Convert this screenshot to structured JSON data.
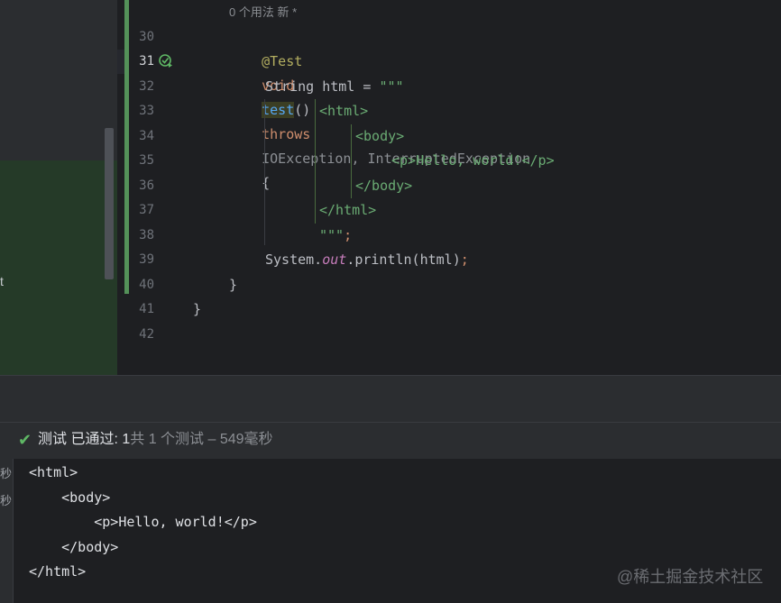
{
  "editor": {
    "usage_hint": "0 个用法  新 *",
    "line_numbers": [
      "30",
      "31",
      "32",
      "33",
      "34",
      "35",
      "36",
      "37",
      "38",
      "39",
      "40",
      "41",
      "42"
    ],
    "annotation": "@Test",
    "method": {
      "void": "void",
      "name": "test",
      "parens": "()",
      "throws": "throws",
      "exceptions": "IOException, InterruptedException",
      "brace": "{"
    },
    "line32": {
      "decl": "String html = ",
      "quote": "\"\"\""
    },
    "line33": "<html>",
    "line34": "<body>",
    "line35": "<p>Hello, world!</p>",
    "line36": "</body>",
    "line37": "</html>",
    "line38": {
      "quote": "\"\"\"",
      "semi": ";"
    },
    "line39": {
      "sys": "System.",
      "out": "out",
      "rest": ".println(html)",
      "semi": ";"
    },
    "line40": "}",
    "line41": "}"
  },
  "left_panel": {
    "fragment": "t"
  },
  "test_status": {
    "check_icon": "check-icon",
    "label": "测试 已通过: 1",
    "detail": "共 1 个测试 – 549毫秒"
  },
  "console": {
    "side_labels": [
      "秒",
      "秒"
    ],
    "lines": [
      "<html>",
      "    <body>",
      "        <p>Hello, world!</p>",
      "    </body>",
      "</html>"
    ]
  },
  "watermark": "@稀土掘金技术社区",
  "colors": {
    "keyword": "#cf8e6d",
    "annotation": "#b3ae60",
    "function": "#56a8f5",
    "string": "#6aab73",
    "pass_green": "#5fb865"
  }
}
